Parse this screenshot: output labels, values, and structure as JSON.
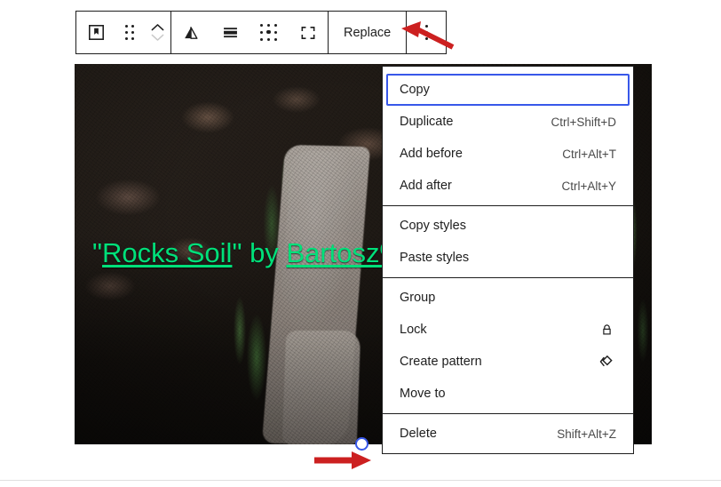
{
  "editor": {
    "block_type": "cover-block",
    "caption": {
      "prefix": "\"",
      "link1": "Rocks Soil",
      "middle": "\" by ",
      "link2": "Bartosz%",
      "full_text": "\"Rocks Soil\" by Bartosz%",
      "color": "#00e07a"
    }
  },
  "toolbar": {
    "block_icon_name": "cover-block-icon",
    "drag_handle_name": "drag-handle-icon",
    "move_up_label": "Move up",
    "move_down_label": "Move down",
    "align_label": "Change alignment",
    "content_position_label": "Change content position",
    "focal_point_label": "Focal point picker",
    "fullheight_label": "Toggle full height",
    "replace_label": "Replace",
    "options_label": "Options"
  },
  "menu": {
    "sections": [
      {
        "items": [
          {
            "label": "Copy",
            "shortcut": "",
            "icon": "",
            "focused": true
          },
          {
            "label": "Duplicate",
            "shortcut": "Ctrl+Shift+D",
            "icon": "",
            "focused": false
          },
          {
            "label": "Add before",
            "shortcut": "Ctrl+Alt+T",
            "icon": "",
            "focused": false
          },
          {
            "label": "Add after",
            "shortcut": "Ctrl+Alt+Y",
            "icon": "",
            "focused": false
          }
        ]
      },
      {
        "items": [
          {
            "label": "Copy styles",
            "shortcut": "",
            "icon": "",
            "focused": false
          },
          {
            "label": "Paste styles",
            "shortcut": "",
            "icon": "",
            "focused": false
          }
        ]
      },
      {
        "items": [
          {
            "label": "Group",
            "shortcut": "",
            "icon": "",
            "focused": false
          },
          {
            "label": "Lock",
            "shortcut": "",
            "icon": "lock-icon",
            "focused": false
          },
          {
            "label": "Create pattern",
            "shortcut": "",
            "icon": "pattern-icon",
            "focused": false
          },
          {
            "label": "Move to",
            "shortcut": "",
            "icon": "",
            "focused": false
          }
        ]
      },
      {
        "items": [
          {
            "label": "Delete",
            "shortcut": "Shift+Alt+Z",
            "icon": "",
            "focused": false
          }
        ]
      }
    ]
  },
  "annotations": {
    "arrow_color": "#cc2020",
    "arrow_top_target": "options-button",
    "arrow_bottom_target": "resize-handle"
  },
  "colors": {
    "focus_blue": "#3858e9",
    "border_dark": "#1e1e1e",
    "caption_green": "#00e07a",
    "arrow_red": "#cc2020"
  }
}
